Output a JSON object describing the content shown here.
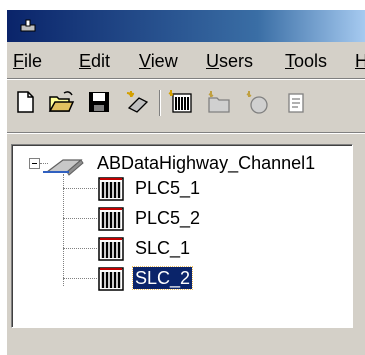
{
  "menu": {
    "items": [
      {
        "label": "File",
        "u": "F",
        "rest": "ile"
      },
      {
        "label": "Edit",
        "u": "E",
        "rest": "dit"
      },
      {
        "label": "View",
        "u": "V",
        "rest": "iew"
      },
      {
        "label": "Users",
        "u": "U",
        "rest": "sers"
      },
      {
        "label": "Tools",
        "u": "T",
        "rest": "ools"
      },
      {
        "label": "H",
        "u": "H",
        "rest": ""
      }
    ]
  },
  "toolbar": {
    "icons": [
      "new-document-icon",
      "open-folder-icon",
      "save-icon",
      "new-channel-icon",
      "new-device-icon",
      "tag-group-icon",
      "new-tag-icon",
      "properties-icon"
    ]
  },
  "tree": {
    "channel": {
      "label": "ABDataHighway_Channel1",
      "expanded": true
    },
    "devices": [
      {
        "label": "PLC5_1",
        "selected": false
      },
      {
        "label": "PLC5_2",
        "selected": false
      },
      {
        "label": "SLC_1",
        "selected": false
      },
      {
        "label": "SLC_2",
        "selected": true
      }
    ]
  }
}
